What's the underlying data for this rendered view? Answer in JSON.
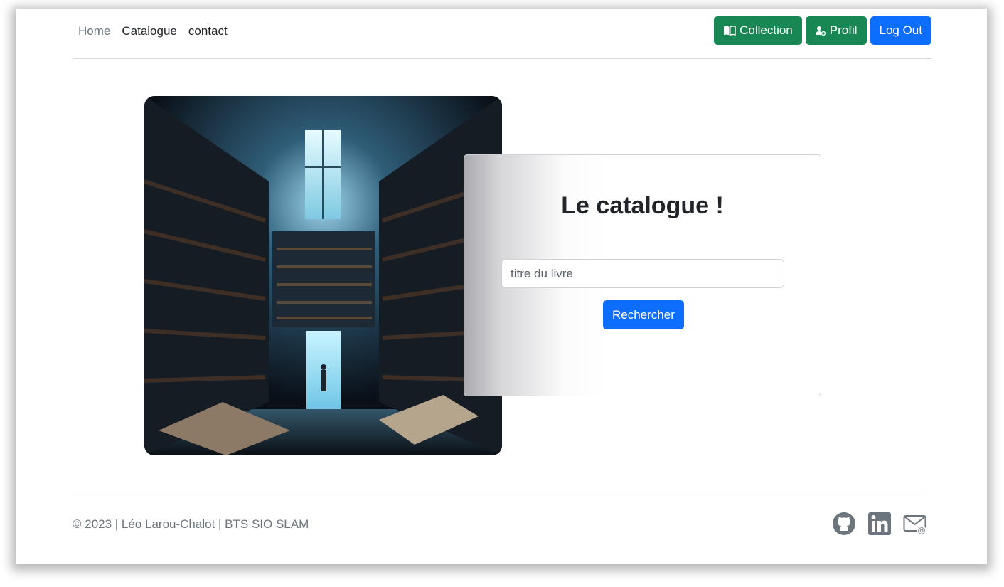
{
  "nav": {
    "links": [
      {
        "label": "Home"
      },
      {
        "label": "Catalogue"
      },
      {
        "label": "contact"
      }
    ],
    "actions": {
      "collection": "Collection",
      "profil": "Profil",
      "logout": "Log Out"
    }
  },
  "catalogue": {
    "title": "Le catalogue !",
    "search_placeholder": "titre du livre",
    "search_button": "Rechercher"
  },
  "footer": {
    "text": "© 2023 | Léo Larou-Chalot | BTS SIO SLAM",
    "icons": [
      "github-icon",
      "linkedin-icon",
      "email-icon"
    ]
  },
  "colors": {
    "primary": "#0d6efd",
    "success": "#198754",
    "text": "#212529",
    "muted": "#6c757d"
  }
}
